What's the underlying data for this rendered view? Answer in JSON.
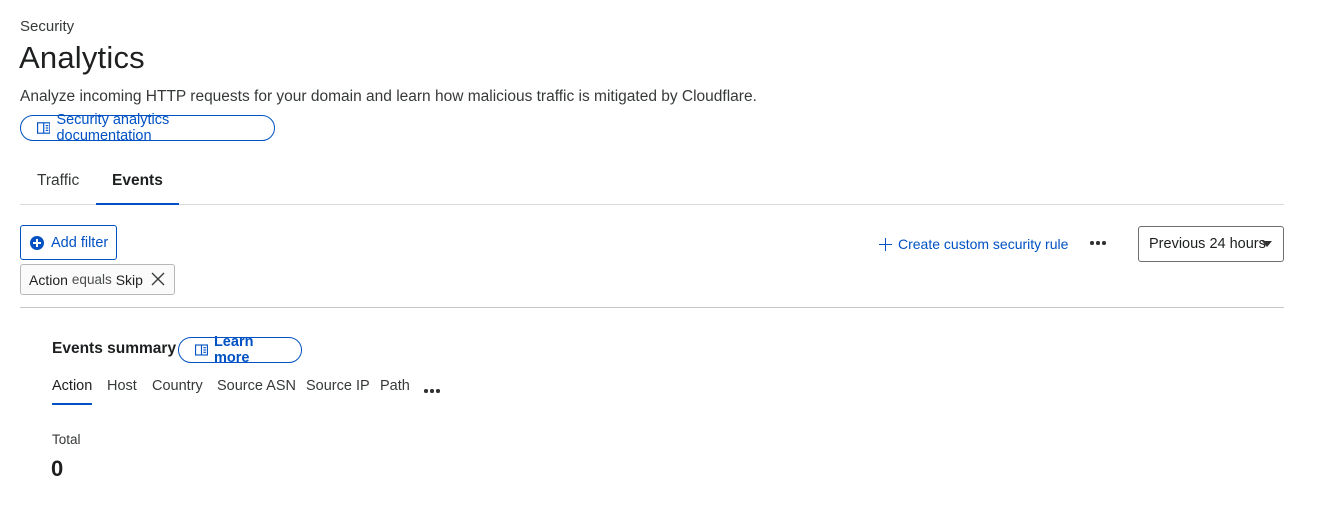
{
  "header": {
    "breadcrumb": "Security",
    "title": "Analytics",
    "description": "Analyze incoming HTTP requests for your domain and learn how malicious traffic is mitigated by Cloudflare.",
    "doc_link_label": "Security analytics documentation",
    "doc_link_icon": "book-icon"
  },
  "tabs": [
    {
      "label": "Traffic",
      "active": false
    },
    {
      "label": "Events",
      "active": true
    }
  ],
  "toolbar": {
    "add_filter_label": "Add filter",
    "add_filter_icon": "plus-circle-icon",
    "create_rule_label": "Create custom security rule",
    "create_rule_icon": "plus-icon",
    "more_icon": "more-horizontal-icon",
    "time_range": "Previous 24 hours"
  },
  "filters": [
    {
      "field": "Action",
      "operator": "equals",
      "value": "Skip"
    }
  ],
  "summary": {
    "title": "Events summary",
    "learn_more_label": "Learn more",
    "tabs": [
      "Action",
      "Host",
      "Country",
      "Source ASN",
      "Source IP",
      "Path"
    ],
    "active_tab": "Action",
    "total_label": "Total",
    "total_value": "0"
  },
  "colors": {
    "accent": "#0051c3",
    "text": "#1d1f20",
    "border": "#d9d9d9"
  }
}
